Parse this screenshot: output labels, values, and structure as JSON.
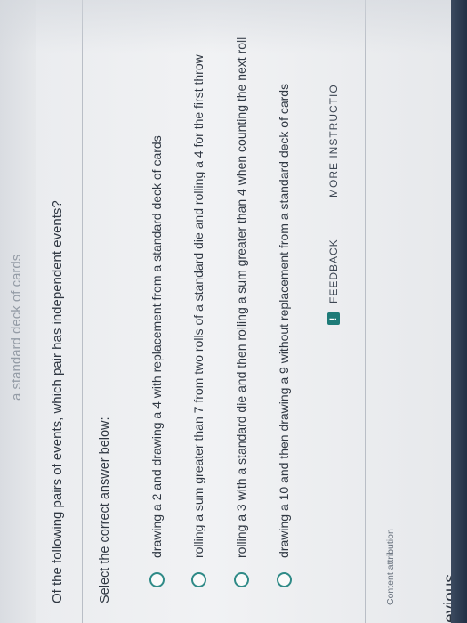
{
  "header": {
    "partial_text": "a standard deck of cards"
  },
  "question": {
    "text": "Of the following pairs of events, which pair has independent events?"
  },
  "instruction": "Select the correct answer below:",
  "options": [
    {
      "label": "drawing a 2 and drawing a 4 with replacement from a standard deck of cards"
    },
    {
      "label": "rolling a sum greater than 7 from two rolls of a standard die and rolling a 4 for the first throw"
    },
    {
      "label": "rolling a 3 with a standard die and then rolling a sum greater than 4 when counting the next roll"
    },
    {
      "label": "drawing a 10 and then drawing a 9 without replacement from a standard deck of cards"
    }
  ],
  "actions": {
    "feedback_icon": "!",
    "feedback_label": "FEEDBACK",
    "more_label": "MORE INSTRUCTIO"
  },
  "footer": {
    "attribution": "Content attribution",
    "previous": "evious"
  },
  "colors": {
    "accent": "#2f8a87",
    "text": "#2f3742",
    "background": "#eceef1"
  }
}
